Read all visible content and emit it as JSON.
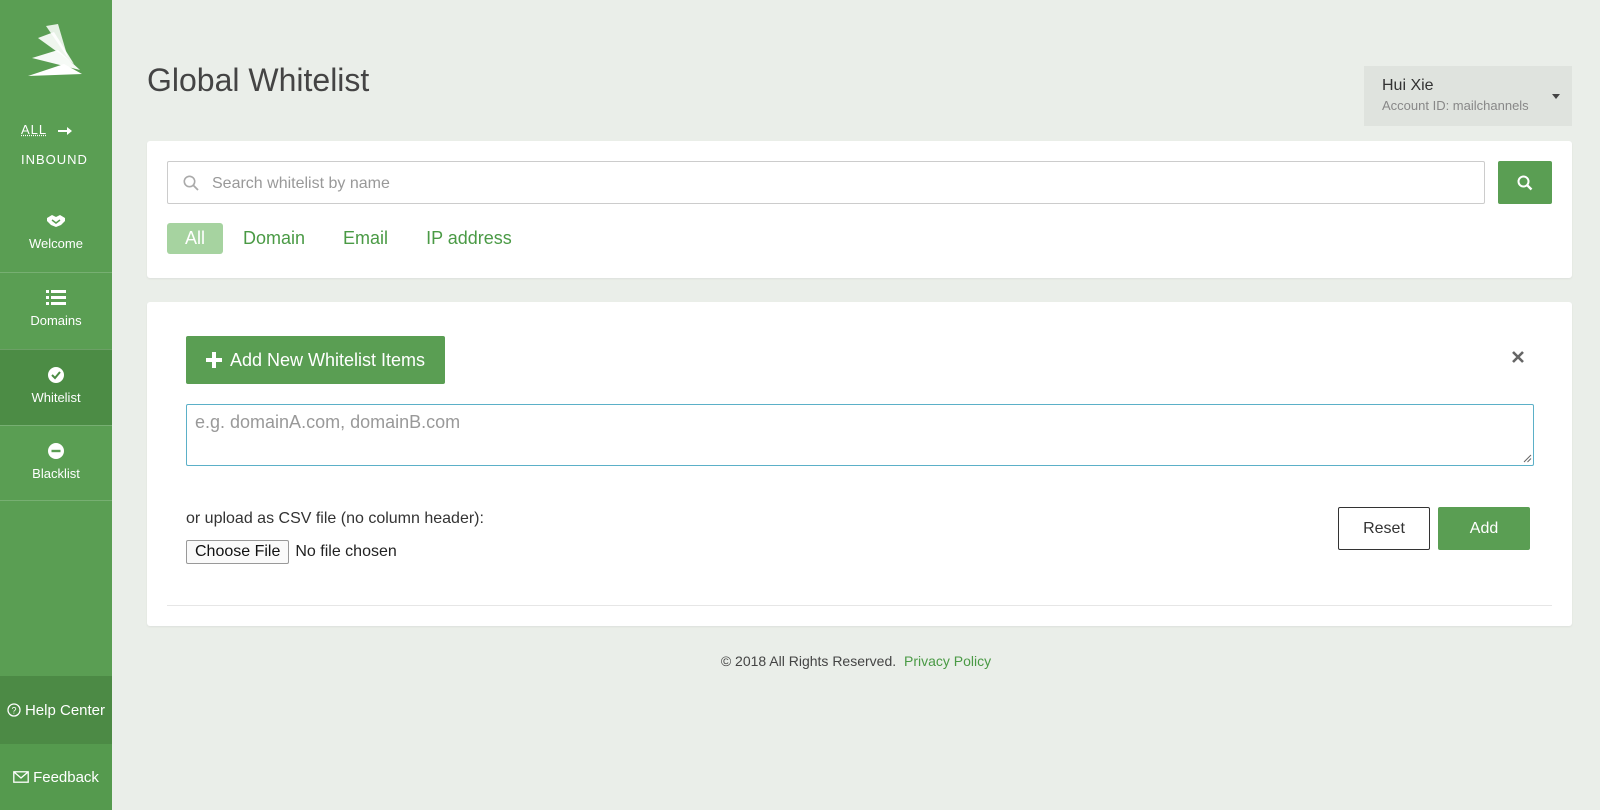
{
  "sidebar": {
    "scope_all": "ALL",
    "scope_inbound": "INBOUND",
    "items": [
      {
        "label": "Welcome",
        "icon": "handshake-icon"
      },
      {
        "label": "Domains",
        "icon": "list-icon"
      },
      {
        "label": "Whitelist",
        "icon": "check-circle-icon"
      },
      {
        "label": "Blacklist",
        "icon": "minus-circle-icon"
      }
    ],
    "help_label": "Help Center",
    "feedback_label": "Feedback"
  },
  "header": {
    "title": "Global Whitelist"
  },
  "account": {
    "name": "Hui Xie",
    "account_id": "Account ID: mailchannels"
  },
  "search": {
    "placeholder": "Search whitelist by name",
    "value": ""
  },
  "filters": [
    "All",
    "Domain",
    "Email",
    "IP address"
  ],
  "add_panel": {
    "add_button": "Add New Whitelist Items",
    "textarea_placeholder": "e.g. domainA.com, domainB.com",
    "upload_label": "or upload as CSV file (no column header):",
    "choose_file": "Choose File",
    "no_file": "No file chosen",
    "reset": "Reset",
    "add": "Add"
  },
  "footer": {
    "copyright": "© 2018 All Rights Reserved.",
    "privacy": "Privacy Policy"
  },
  "colors": {
    "brand_green": "#5a9e53",
    "active_green": "#4c8c45",
    "link_green": "#4a9a45",
    "filter_active": "#a6d3a0",
    "background": "#eaeee9"
  }
}
